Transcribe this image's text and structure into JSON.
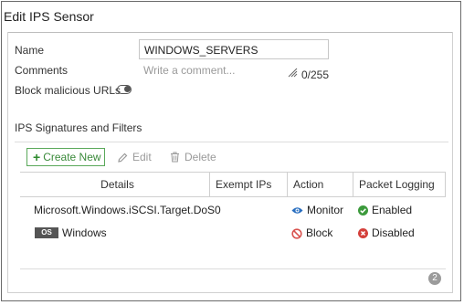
{
  "window": {
    "title": "Edit IPS Sensor"
  },
  "form": {
    "name_label": "Name",
    "name_value": "WINDOWS_SERVERS",
    "comments_label": "Comments",
    "comments_placeholder": "Write a comment...",
    "char_count": "0/255",
    "block_urls_label": "Block malicious URLs",
    "block_urls_enabled": false
  },
  "section": {
    "title": "IPS Signatures and Filters"
  },
  "toolbar": {
    "create_label": "Create New",
    "edit_label": "Edit",
    "delete_label": "Delete"
  },
  "table": {
    "headers": [
      "Details",
      "Exempt IPs",
      "Action",
      "Packet Logging"
    ],
    "rows": [
      {
        "details": "Microsoft.Windows.iSCSI.Target.DoS",
        "exempt": "0",
        "action": "Monitor",
        "logging": "Enabled"
      },
      {
        "badge": "OS",
        "details": "Windows",
        "exempt": "",
        "action": "Block",
        "logging": "Disabled"
      }
    ]
  },
  "footer": {
    "help_count": "2"
  },
  "colors": {
    "accent_green": "#3a8a3a",
    "monitor_blue": "#2a6fc0",
    "block_red": "#d9534f",
    "enabled_green": "#3c9a3c",
    "disabled_red": "#d43f3a"
  }
}
